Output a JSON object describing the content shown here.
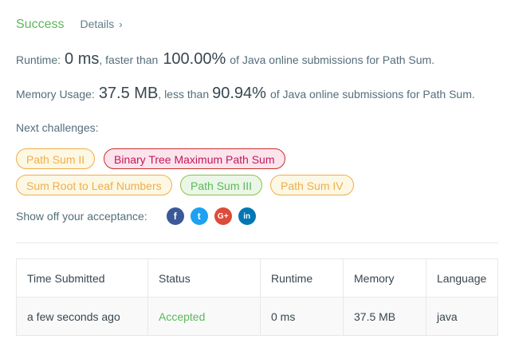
{
  "header": {
    "status": "Success",
    "details_label": "Details",
    "details_chevron": "›"
  },
  "runtime": {
    "label": "Runtime:",
    "value": "0 ms",
    "mid": ", faster than",
    "percent": "100.00%",
    "tail": "of Java online submissions for Path Sum."
  },
  "memory": {
    "label": "Memory Usage:",
    "value": "37.5 MB",
    "mid": ", less than",
    "percent": "90.94%",
    "tail": "of Java online submissions for Path Sum."
  },
  "next_challenges": {
    "label": "Next challenges:",
    "items": [
      {
        "label": "Path Sum II",
        "difficulty": "medium"
      },
      {
        "label": "Binary Tree Maximum Path Sum",
        "difficulty": "hard"
      },
      {
        "label": "Sum Root to Leaf Numbers",
        "difficulty": "medium"
      },
      {
        "label": "Path Sum III",
        "difficulty": "easy"
      },
      {
        "label": "Path Sum IV",
        "difficulty": "medium"
      }
    ]
  },
  "share": {
    "label": "Show off your acceptance:",
    "icons": [
      {
        "name": "facebook-icon",
        "glyph": "f",
        "color": "#3b5998"
      },
      {
        "name": "twitter-icon",
        "glyph": "t",
        "color": "#1da1f2"
      },
      {
        "name": "google-plus-icon",
        "glyph": "G+",
        "color": "#dd4b39"
      },
      {
        "name": "linkedin-icon",
        "glyph": "in",
        "color": "#0077b5"
      }
    ]
  },
  "table": {
    "headers": [
      "Time Submitted",
      "Status",
      "Runtime",
      "Memory",
      "Language"
    ],
    "rows": [
      [
        "a few seconds ago",
        "Accepted",
        "0 ms",
        "37.5 MB",
        "java"
      ]
    ]
  }
}
